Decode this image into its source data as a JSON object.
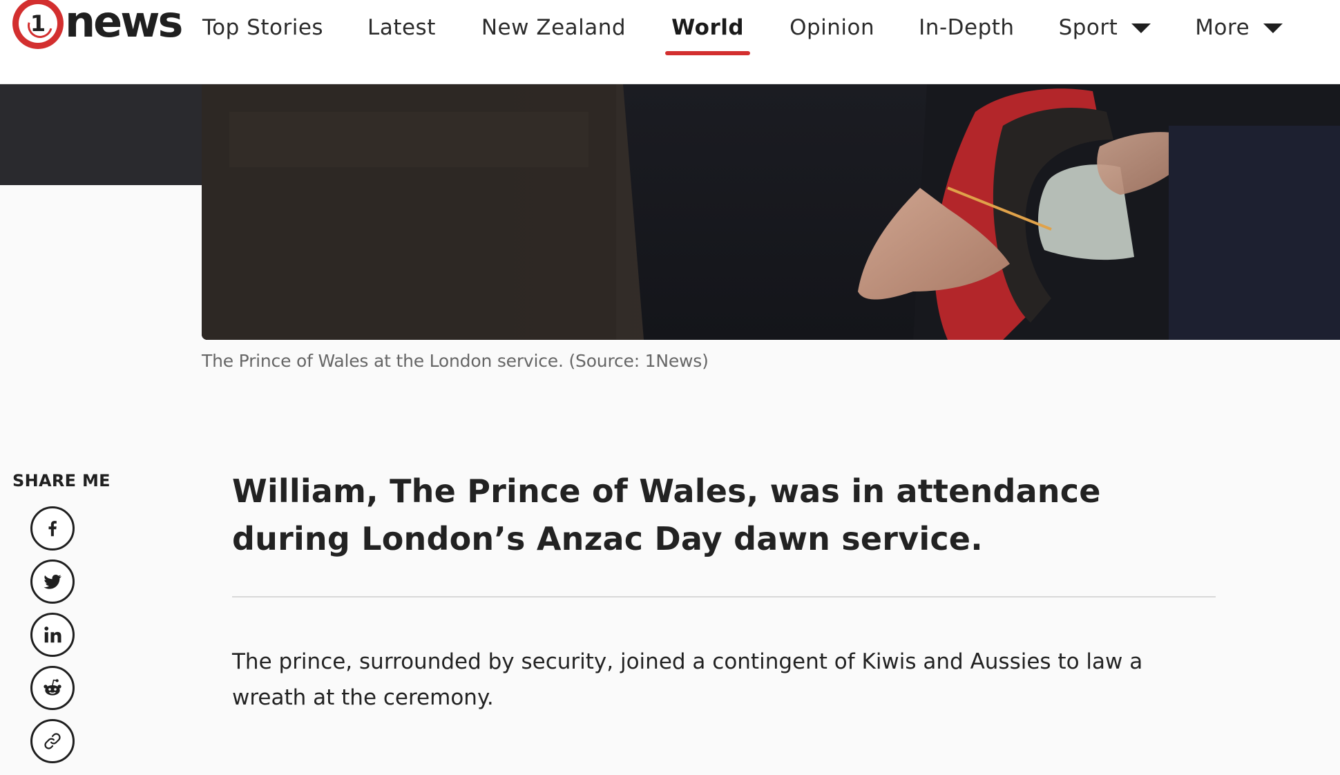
{
  "brand": {
    "logo_number": "1",
    "logo_word": "news",
    "accent_color": "#d32f2f"
  },
  "nav": {
    "items": [
      {
        "label": "Top Stories",
        "active": false,
        "has_dropdown": false
      },
      {
        "label": "Latest",
        "active": false,
        "has_dropdown": false
      },
      {
        "label": "New Zealand",
        "active": false,
        "has_dropdown": false
      },
      {
        "label": "World",
        "active": true,
        "has_dropdown": false
      },
      {
        "label": "Opinion",
        "active": false,
        "has_dropdown": false
      },
      {
        "label": "In-Depth",
        "active": false,
        "has_dropdown": false
      },
      {
        "label": "Sport",
        "active": false,
        "has_dropdown": true
      },
      {
        "label": "More",
        "active": false,
        "has_dropdown": true
      }
    ]
  },
  "hero": {
    "caption": "The Prince of Wales at the London service. (Source: 1News)"
  },
  "share": {
    "title": "SHARE ME",
    "buttons": [
      {
        "icon": "facebook-icon"
      },
      {
        "icon": "twitter-icon"
      },
      {
        "icon": "linkedin-icon"
      },
      {
        "icon": "reddit-icon"
      },
      {
        "icon": "link-icon"
      }
    ]
  },
  "article": {
    "headline": "William, The Prince of Wales, was in attendance during London’s Anzac Day dawn service.",
    "paragraphs": [
      "The prince, surrounded by security, joined a contingent of Kiwis and Aussies to law a wreath at the ceremony."
    ]
  }
}
